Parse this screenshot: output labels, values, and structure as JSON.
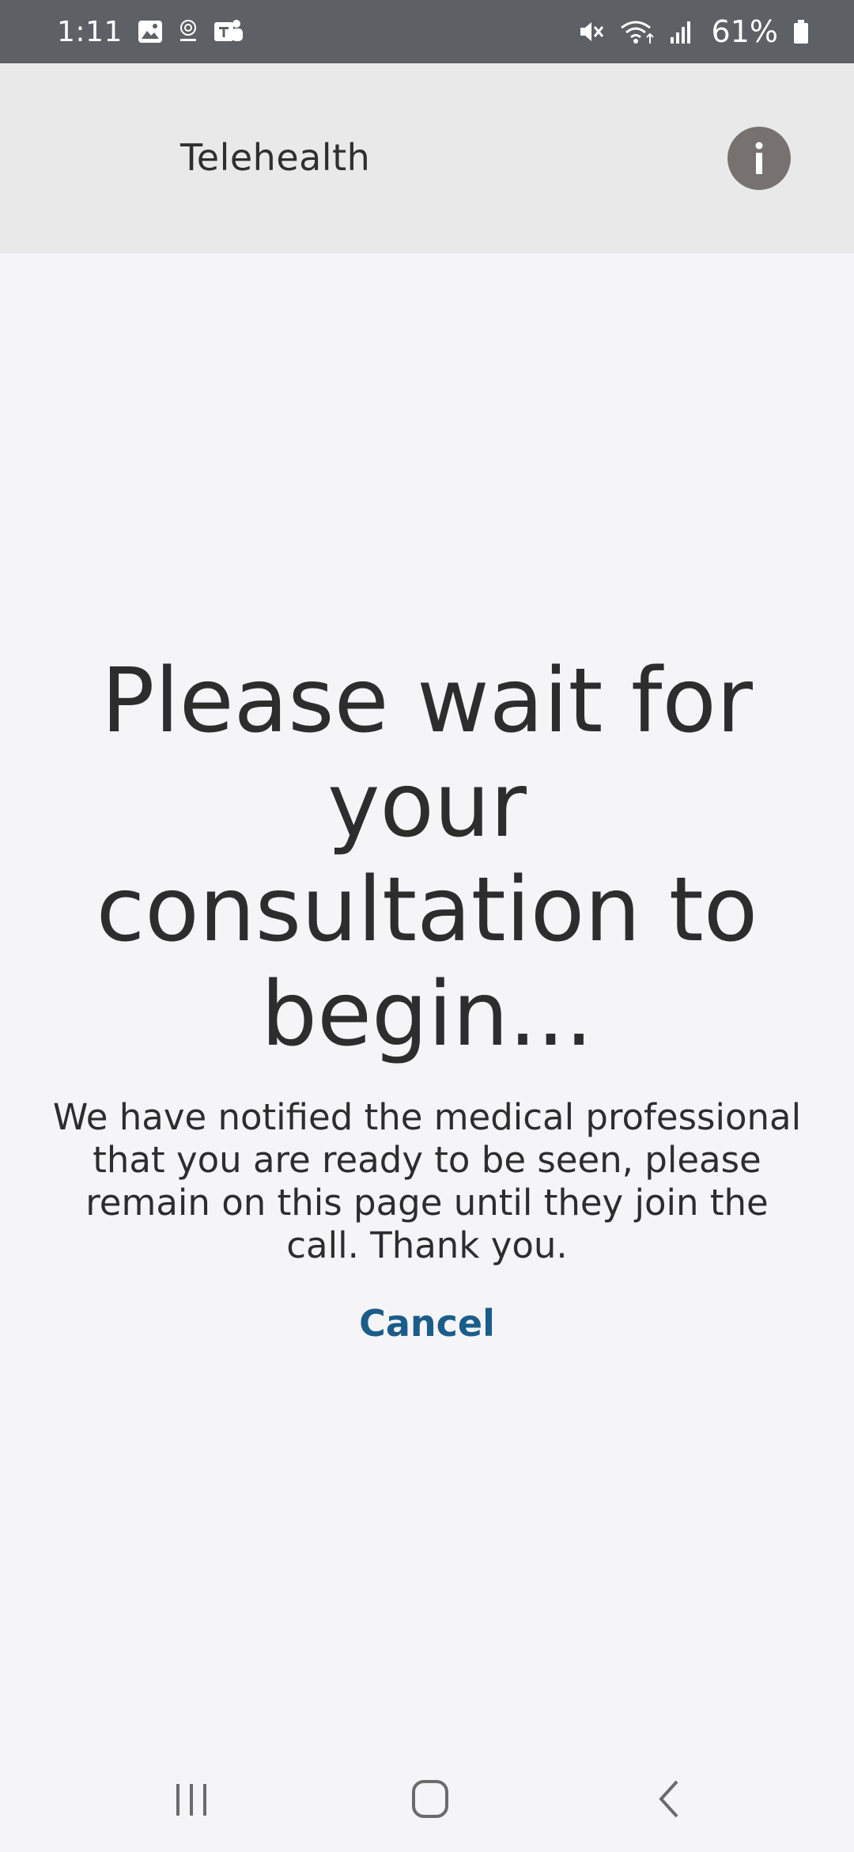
{
  "status_bar": {
    "time": "1:11",
    "battery_percent": "61%",
    "icons": [
      "gallery-icon",
      "clinic-icon",
      "teams-icon",
      "mute-icon",
      "wifi-icon",
      "signal-icon",
      "battery-icon"
    ]
  },
  "header": {
    "title": "Telehealth",
    "info_icon": "info-icon"
  },
  "main": {
    "headline": "Please wait for your consultation to begin...",
    "message": "We have notified the medical professional that you are ready to be seen, please remain on this page until they join the call. Thank you.",
    "cancel_label": "Cancel"
  },
  "nav_bar": {
    "buttons": [
      "recents-icon",
      "home-icon",
      "back-icon"
    ]
  },
  "colors": {
    "status_bar_bg": "#5d6064",
    "header_bg": "#e9e9ea",
    "page_bg": "#f5f4f6",
    "info_button_bg": "#77726f",
    "cancel_link": "#1a5d8a",
    "text": "#2e2d2d"
  }
}
